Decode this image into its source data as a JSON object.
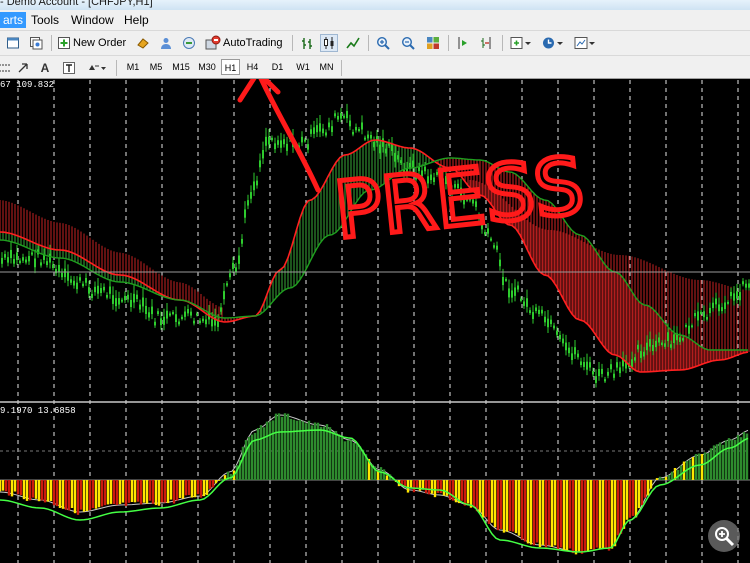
{
  "window": {
    "title": "- Demo Account - [CHFJPY,H1]"
  },
  "menu": {
    "items": [
      "arts",
      "Tools",
      "Window",
      "Help"
    ]
  },
  "toolbar": {
    "new_order_label": "New Order",
    "autotrading_label": "AutoTrading"
  },
  "timeframes": [
    "M1",
    "M5",
    "M15",
    "M30",
    "H1",
    "H4",
    "D1",
    "W1",
    "MN"
  ],
  "active_timeframe": "H1",
  "main_chart": {
    "info_text": "67 109.832"
  },
  "oscillator": {
    "info_text": "9.1970 13.6858"
  },
  "annotation": {
    "text": "PRESS",
    "color": "#ff1a1a"
  },
  "colors": {
    "candle": "#2ecc2e",
    "ma_red": "#ff2020",
    "ma_green": "#1f9f1f",
    "fill_green": "#2e8b2e",
    "fill_red": "#b21f1f",
    "osc_yellow": "#ffe600",
    "osc_line": "#44ff44"
  }
}
